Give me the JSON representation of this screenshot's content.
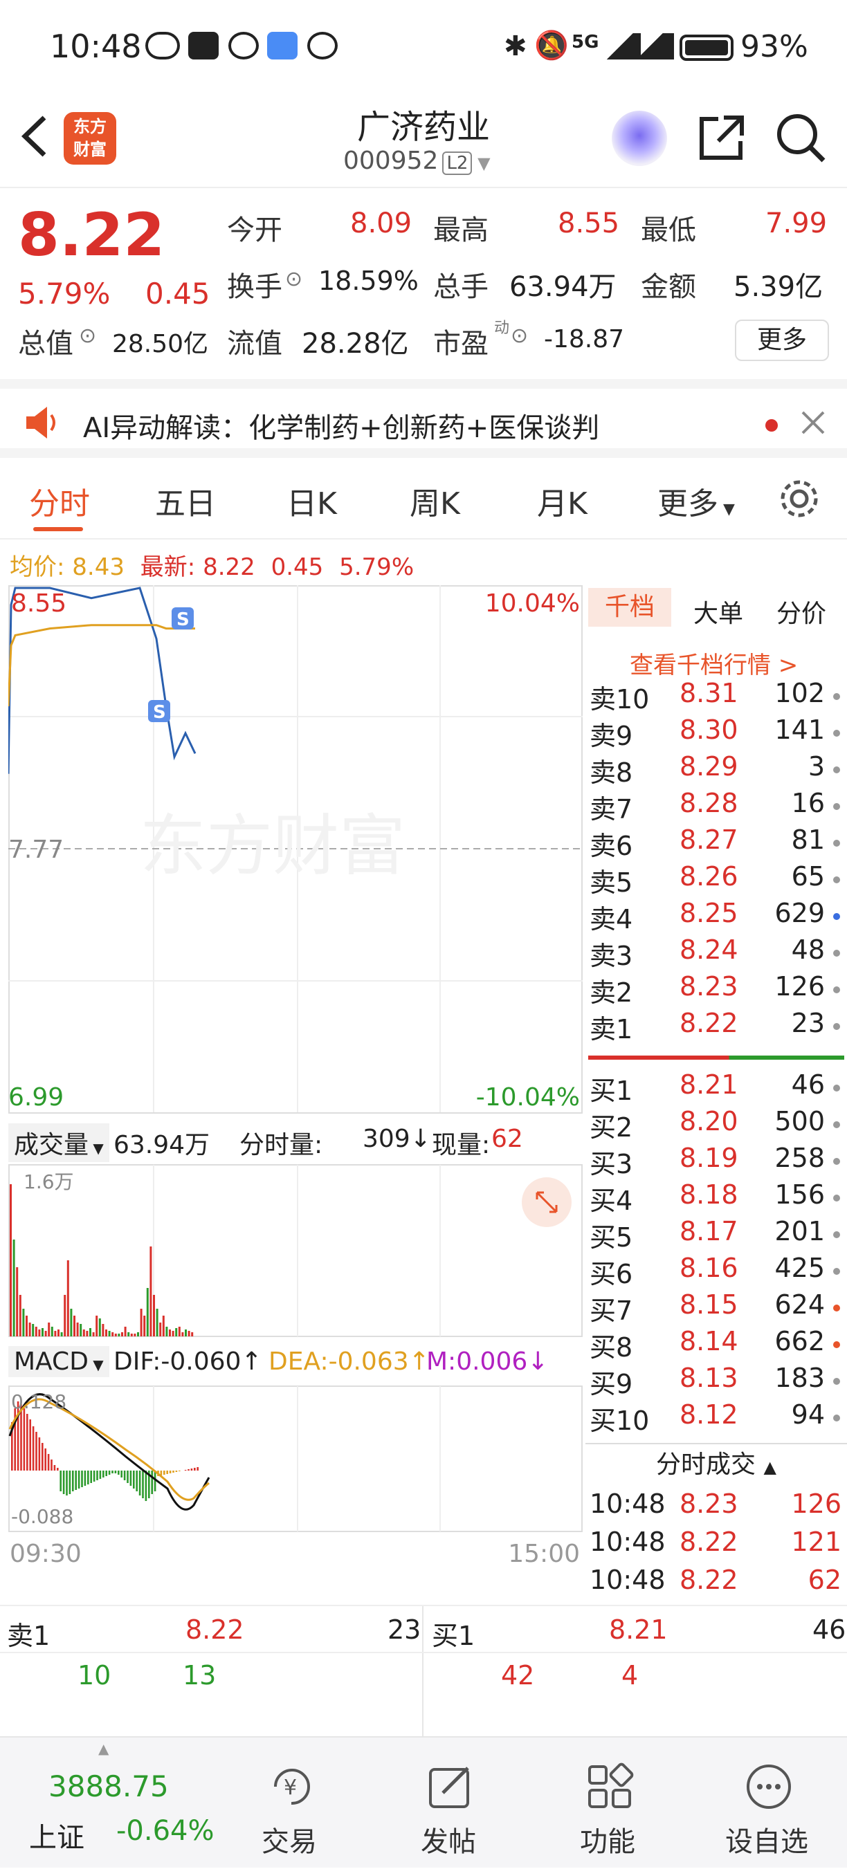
{
  "status": {
    "time": "10:48",
    "battery": "93%",
    "network": "5G"
  },
  "header": {
    "logo_line1": "东方",
    "logo_line2": "财富",
    "title": "广济药业",
    "code": "000952",
    "level": "L2"
  },
  "quote": {
    "price": "8.22",
    "pct": "5.79%",
    "change": "0.45",
    "open_label": "今开",
    "open": "8.09",
    "high_label": "最高",
    "high": "8.55",
    "low_label": "最低",
    "low": "7.99",
    "turnover_label": "换手",
    "turnover": "18.59%",
    "volume_label": "总手",
    "volume": "63.94万",
    "amount_label": "金额",
    "amount": "5.39亿",
    "mcap_label": "总值",
    "mcap": "28.50亿",
    "float_label": "流值",
    "float": "28.28亿",
    "pe_label": "市盈",
    "pe_sup": "动",
    "pe": "-18.87",
    "more": "更多"
  },
  "ai": {
    "text": "AI异动解读：化学制药+创新药+医保谈判"
  },
  "tabs": [
    "分时",
    "五日",
    "日K",
    "周K",
    "月K",
    "更多"
  ],
  "avgline": {
    "avg_label": "均价:",
    "avg": "8.43",
    "latest_label": "最新:",
    "latest": "8.22",
    "chg": "0.45",
    "pct": "5.79%"
  },
  "chart": {
    "top_price": "8.55",
    "top_pct": "10.04%",
    "mid_price": "7.77",
    "bottom_price": "6.99",
    "bottom_pct": "-10.04%",
    "vol_label": "成交量",
    "vol_total": "63.94万",
    "fenshi_label": "分时量:",
    "fenshi_val": "309",
    "now_label": "现量:",
    "now_val": "62",
    "vol_max": "1.6万",
    "macd_label": "MACD",
    "dif": "DIF:-0.060",
    "dea": "DEA:-0.063",
    "m": "M:0.006",
    "macd_top": "0.128",
    "macd_bottom": "-0.088",
    "time_start": "09:30",
    "time_end": "15:00",
    "watermark": "东方财富"
  },
  "chart_data": {
    "type": "line",
    "series": [
      {
        "name": "最新",
        "values": [
          8.0,
          8.5,
          8.55,
          8.55,
          8.52,
          8.55,
          8.4,
          8.2,
          8.05,
          8.12,
          8.06
        ]
      },
      {
        "name": "均价",
        "values": [
          8.2,
          8.38,
          8.41,
          8.43,
          8.44,
          8.44,
          8.44,
          8.43,
          8.43,
          8.43,
          8.43
        ]
      }
    ],
    "ylim": [
      6.99,
      8.55
    ]
  },
  "orderbook": {
    "tabs": [
      "千档",
      "大单",
      "分价"
    ],
    "link": "查看千档行情 >",
    "sells": [
      [
        "卖10",
        "8.31",
        "102"
      ],
      [
        "卖9",
        "8.30",
        "141"
      ],
      [
        "卖8",
        "8.29",
        "3"
      ],
      [
        "卖7",
        "8.28",
        "16"
      ],
      [
        "卖6",
        "8.27",
        "81"
      ],
      [
        "卖5",
        "8.26",
        "65"
      ],
      [
        "卖4",
        "8.25",
        "629"
      ],
      [
        "卖3",
        "8.24",
        "48"
      ],
      [
        "卖2",
        "8.23",
        "126"
      ],
      [
        "卖1",
        "8.22",
        "23"
      ]
    ],
    "buys": [
      [
        "买1",
        "8.21",
        "46"
      ],
      [
        "买2",
        "8.20",
        "500"
      ],
      [
        "买3",
        "8.19",
        "258"
      ],
      [
        "买4",
        "8.18",
        "156"
      ],
      [
        "买5",
        "8.17",
        "201"
      ],
      [
        "买6",
        "8.16",
        "425"
      ],
      [
        "买7",
        "8.15",
        "624"
      ],
      [
        "买8",
        "8.14",
        "662"
      ],
      [
        "买9",
        "8.13",
        "183"
      ],
      [
        "买10",
        "8.12",
        "94"
      ]
    ],
    "trades_title": "分时成交",
    "trades": [
      [
        "10:48",
        "8.23",
        "126"
      ],
      [
        "10:48",
        "8.22",
        "121"
      ],
      [
        "10:48",
        "8.22",
        "62"
      ]
    ]
  },
  "bottomquote": {
    "sell_label": "卖1",
    "sell_price": "8.22",
    "sell_vol": "23",
    "buy_label": "买1",
    "buy_price": "8.21",
    "buy_vol": "46",
    "s1": "10",
    "s2": "13",
    "b1": "42",
    "b2": "4"
  },
  "nav": {
    "index": "3888.75",
    "index_name": "上证",
    "index_pct": "-0.64%",
    "items": [
      "交易",
      "发帖",
      "功能",
      "设自选"
    ]
  }
}
